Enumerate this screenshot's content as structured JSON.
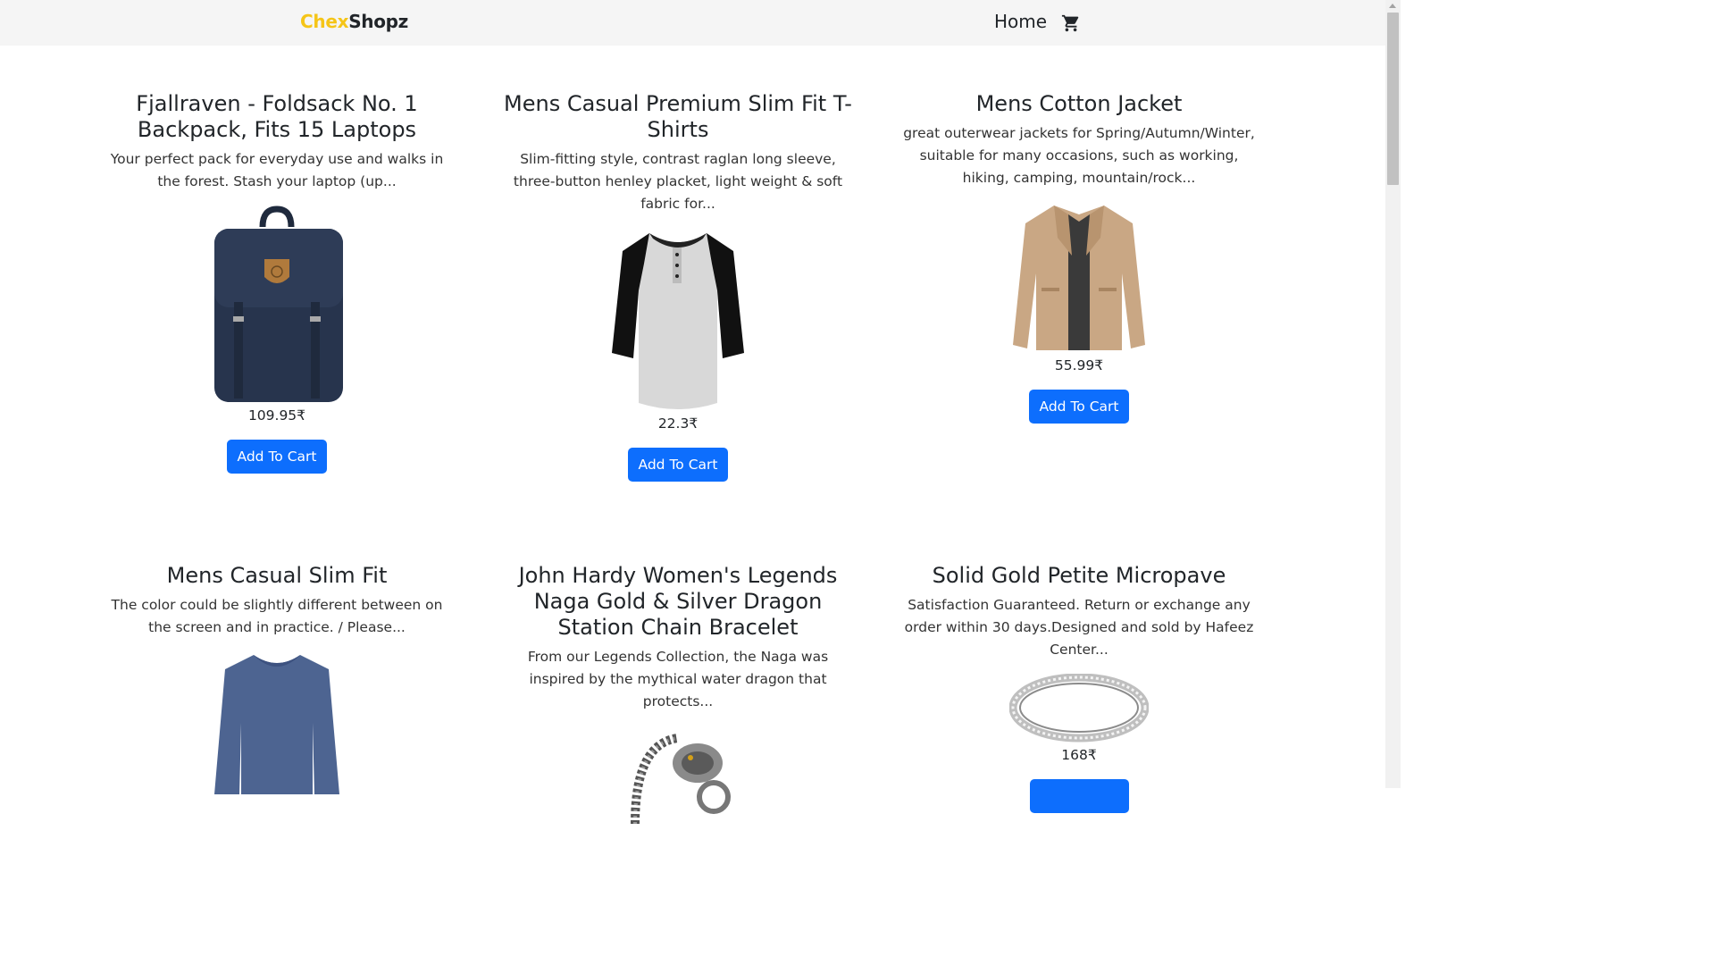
{
  "brand": {
    "part1": "Chex",
    "part2": "Shopz",
    "color_accent": "#f5c518"
  },
  "nav": {
    "home_label": "Home",
    "cart_icon": "cart-icon"
  },
  "button_color": "#0d6efd",
  "products": [
    {
      "title": "Fjallraven - Foldsack No. 1 Backpack, Fits 15 Laptops",
      "description": "Your perfect pack for everyday use and walks in the forest. Stash your laptop (up...",
      "price": "109.95₹",
      "button": "Add To Cart",
      "image": "backpack-image"
    },
    {
      "title": "Mens Casual Premium Slim Fit T-Shirts",
      "description": "Slim-fitting style, contrast raglan long sleeve, three-button henley placket, light weight & soft fabric for...",
      "price": "22.3₹",
      "button": "Add To Cart",
      "image": "tshirt-image"
    },
    {
      "title": "Mens Cotton Jacket",
      "description": "great outerwear jackets for Spring/Autumn/Winter, suitable for many occasions, such as working, hiking, camping, mountain/rock...",
      "price": "55.99₹",
      "button": "Add To Cart",
      "image": "jacket-image"
    },
    {
      "title": "Mens Casual Slim Fit",
      "description": "The color could be slightly different between on the screen and in practice. / Please...",
      "image": "longsleeve-image"
    },
    {
      "title": "John Hardy Women's Legends Naga Gold & Silver Dragon Station Chain Bracelet",
      "description": "From our Legends Collection, the Naga was inspired by the mythical water dragon that protects...",
      "image": "bracelet-image"
    },
    {
      "title": "Solid Gold Petite Micropave",
      "description": "Satisfaction Guaranteed. Return or exchange any order within 30 days.Designed and sold by Hafeez Center...",
      "price": "168₹",
      "image": "ring-image"
    }
  ]
}
